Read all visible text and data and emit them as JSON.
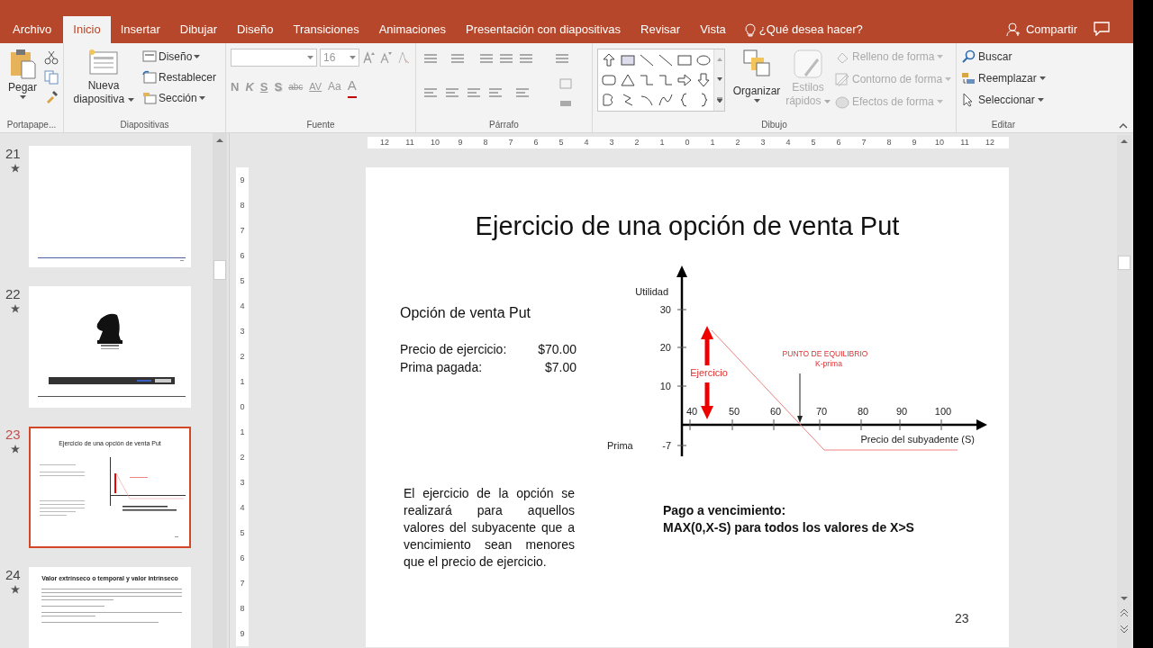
{
  "tabs": [
    {
      "label": "Archivo",
      "selected": false
    },
    {
      "label": "Inicio",
      "selected": true
    },
    {
      "label": "Insertar",
      "selected": false
    },
    {
      "label": "Dibujar",
      "selected": false
    },
    {
      "label": "Diseño",
      "selected": false
    },
    {
      "label": "Transiciones",
      "selected": false
    },
    {
      "label": "Animaciones",
      "selected": false
    },
    {
      "label": "Presentación con diapositivas",
      "selected": false
    },
    {
      "label": "Revisar",
      "selected": false
    },
    {
      "label": "Vista",
      "selected": false
    }
  ],
  "tell_me": "¿Qué desea hacer?",
  "share_button": "Compartir",
  "ribbon": {
    "clipboard": {
      "label": "Portapape...",
      "paste": "Pegar"
    },
    "slides": {
      "label": "Diapositivas",
      "new_slide": [
        "Nueva",
        "diapositiva"
      ],
      "buttons": [
        "Diseño",
        "Restablecer",
        "Sección"
      ]
    },
    "font": {
      "label": "Fuente",
      "font_size": "16",
      "format_buttons": [
        {
          "text": "N",
          "kind": "bold"
        },
        {
          "text": "K",
          "kind": "italic"
        },
        {
          "text": "S",
          "kind": "underline"
        },
        {
          "text": "S",
          "kind": "shadow"
        },
        {
          "text": "abc",
          "kind": "strike"
        },
        {
          "text": "AV",
          "kind": "spacing"
        },
        {
          "text": "Aa",
          "kind": "case"
        },
        {
          "text": "A",
          "kind": "color"
        }
      ]
    },
    "paragraph": {
      "label": "Párrafo"
    },
    "drawing": {
      "label": "Dibujo",
      "arrange": "Organizar",
      "quick_styles": {
        "lines": [
          "Estilos",
          "rápidos"
        ],
        "disabled": true
      },
      "shape_buttons": [
        {
          "label": "Relleno de forma",
          "disabled": true
        },
        {
          "label": "Contorno de forma",
          "disabled": true
        },
        {
          "label": "Efectos de forma",
          "disabled": true
        }
      ]
    },
    "editing": {
      "label": "Editar",
      "buttons": [
        "Buscar",
        "Reemplazar",
        "Seleccionar"
      ]
    }
  },
  "slides_panel": [
    {
      "number": "21",
      "selected": false,
      "kind": "blank"
    },
    {
      "number": "22",
      "selected": false,
      "kind": "image"
    },
    {
      "number": "23",
      "selected": true,
      "kind": "chart",
      "title": "Ejercicio de una opción de venta Put"
    },
    {
      "number": "24",
      "selected": false,
      "kind": "text",
      "title": "Valor extrínseco o temporal y valor intrínseco"
    }
  ],
  "horizontal_ruler": [
    "12",
    "11",
    "10",
    "9",
    "8",
    "7",
    "6",
    "5",
    "4",
    "3",
    "2",
    "1",
    "0",
    "1",
    "2",
    "3",
    "4",
    "5",
    "6",
    "7",
    "8",
    "9",
    "10",
    "11",
    "12"
  ],
  "vertical_ruler": [
    "9",
    "8",
    "7",
    "6",
    "5",
    "4",
    "3",
    "2",
    "1",
    "0",
    "1",
    "2",
    "3",
    "4",
    "5",
    "6",
    "7",
    "8",
    "9"
  ],
  "slide": {
    "title": "Ejercicio de una opción de venta Put",
    "subtitle": "Opción de venta Put",
    "details": [
      {
        "label": "Precio de ejercicio:",
        "value": "$70.00"
      },
      {
        "label": "Prima pagada:",
        "value": "$7.00"
      }
    ],
    "paragraph": "El ejercicio de la opción se realizará para aquellos valores del subyacente que a vencimiento sean menores que el precio de ejercicio.",
    "payoff": [
      "Pago a vencimiento:",
      "MAX(0,X-S) para todos los valores de X>S"
    ],
    "page_number": "23",
    "diagram": {
      "y_title": "Utilidad",
      "y_labels": [
        "30",
        "20",
        "10",
        "-7"
      ],
      "premium_label": "Prima",
      "x_labels": [
        "40",
        "50",
        "60",
        "70",
        "80",
        "90",
        "100"
      ],
      "x_title": "Precio del subyadente (S)",
      "exercise_label": "Ejercicio",
      "breakeven_label": "PUNTO DE EQUILIBRIO",
      "breakeven_formula": "K-prima"
    }
  }
}
